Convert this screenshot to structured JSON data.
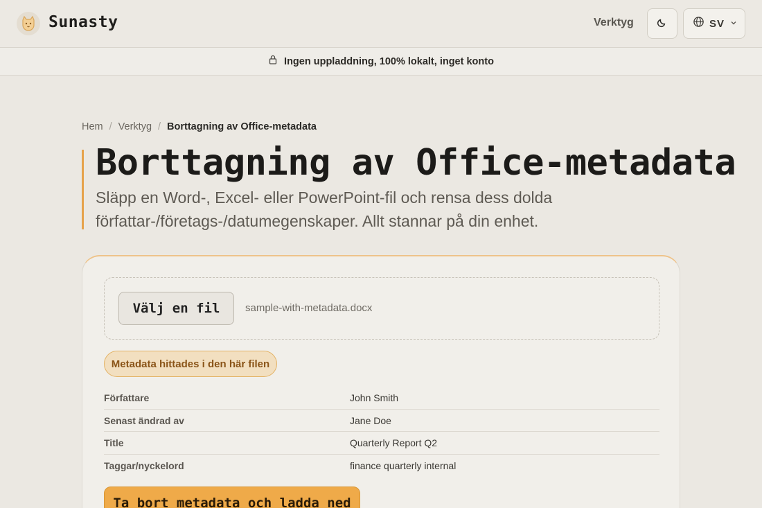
{
  "header": {
    "brand": "Sunasty",
    "nav_tools": "Verktyg",
    "language_code": "SV"
  },
  "banner": {
    "text": "Ingen uppladdning, 100% lokalt, inget konto"
  },
  "breadcrumb": {
    "items": [
      "Hem",
      "Verktyg",
      "Borttagning av Office-metadata"
    ],
    "separator": "/"
  },
  "page": {
    "title": "Borttagning av Office-metadata",
    "subtitle": "Släpp en Word-, Excel- eller PowerPoint-fil och rensa dess dolda författar-/företags-/datumegenskaper. Allt stannar på din enhet."
  },
  "file_picker": {
    "button_label": "Välj en fil",
    "selected_file": "sample-with-metadata.docx"
  },
  "status": {
    "badge": "Metadata hittades i den här filen"
  },
  "metadata": {
    "rows": [
      {
        "key": "Författare",
        "value": "John Smith"
      },
      {
        "key": "Senast ändrad av",
        "value": "Jane Doe"
      },
      {
        "key": "Title",
        "value": "Quarterly Report Q2"
      },
      {
        "key": "Taggar/nyckelord",
        "value": "finance quarterly internal"
      }
    ]
  },
  "actions": {
    "download_label": "Ta bort metadata och ladda ned"
  },
  "colors": {
    "accent": "#efaa49",
    "accent_border": "#e6a24a",
    "badge_bg": "#f2dfc0",
    "badge_text": "#8a5418",
    "background": "#ebe8e2"
  },
  "icons": {
    "logo": "cat-logo-icon",
    "theme": "moon-icon",
    "language": "globe-icon",
    "dropdown": "chevron-down-icon",
    "banner": "lock-icon"
  }
}
